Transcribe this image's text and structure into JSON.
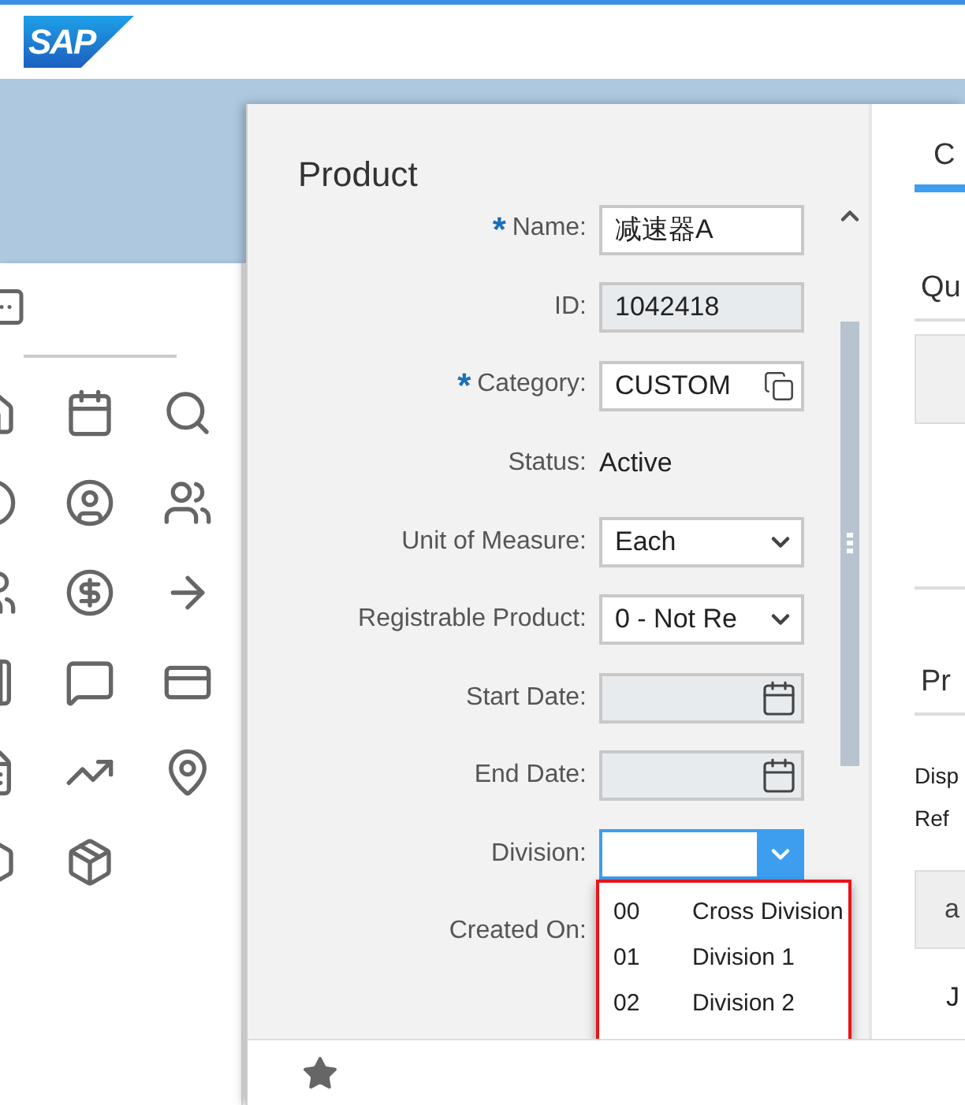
{
  "header": {
    "logo": "SAP"
  },
  "dialog": {
    "title": "Product",
    "required_mark": "*",
    "fields": [
      {
        "label": "Name:",
        "required": true,
        "kind": "text",
        "value": "减速器A"
      },
      {
        "label": "ID:",
        "required": false,
        "kind": "readonly",
        "value": "1042418"
      },
      {
        "label": "Category:",
        "required": true,
        "kind": "valuehelp",
        "value": "CUSTOM"
      },
      {
        "label": "Status:",
        "required": false,
        "kind": "static",
        "value": "Active"
      },
      {
        "label": "Unit of Measure:",
        "required": false,
        "kind": "select",
        "value": "Each",
        "expanded": false
      },
      {
        "label": "Registrable Product:",
        "required": false,
        "kind": "select",
        "value": "0 - Not Re",
        "expanded": false
      },
      {
        "label": "Start Date:",
        "required": false,
        "kind": "date"
      },
      {
        "label": "End Date:",
        "required": false,
        "kind": "date"
      },
      {
        "label": "Division:",
        "required": false,
        "kind": "select",
        "expanded": true
      },
      {
        "label": "Created On:",
        "required": false,
        "kind": "static"
      }
    ],
    "dropdown_options": [
      {
        "code": "00",
        "text": "Cross Division"
      },
      {
        "code": "01",
        "text": "Division 1"
      },
      {
        "code": "02",
        "text": "Division 2"
      }
    ]
  },
  "right_pane": {
    "tab": {
      "label": "C",
      "selected": true
    },
    "section_1": "Qu",
    "section_2": "Pr",
    "text_lines": [
      "Disp",
      "Ref"
    ],
    "table_header": "a",
    "table_cell": "J"
  }
}
